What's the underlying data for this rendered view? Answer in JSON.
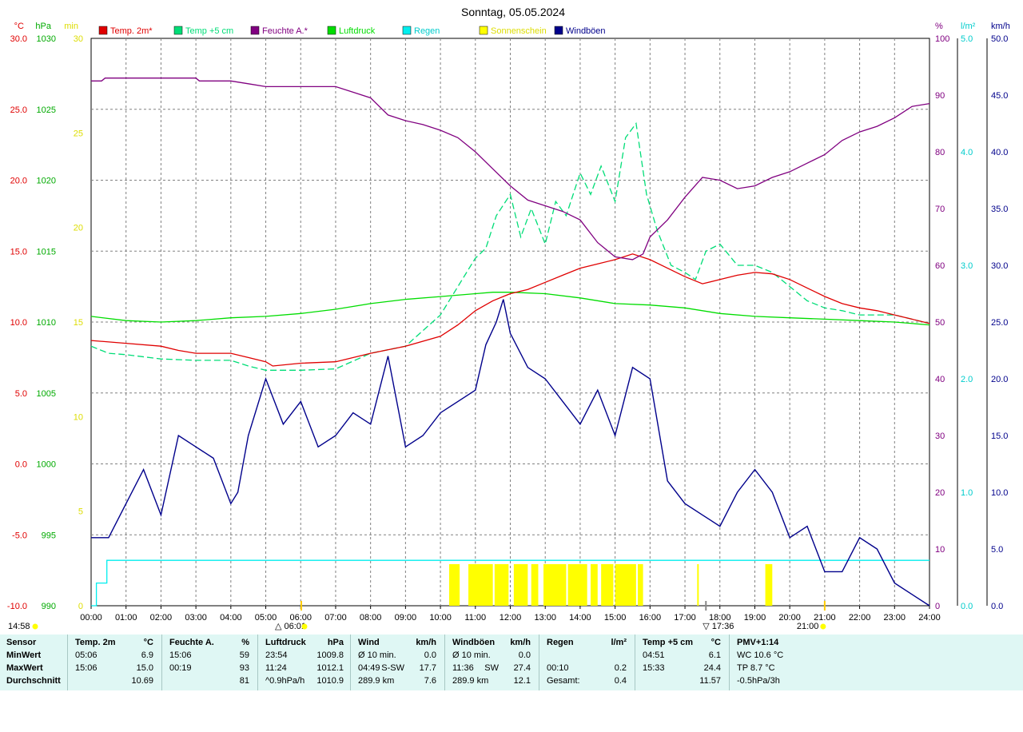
{
  "title": "Sonntag, 05.05.2024",
  "colors": {
    "temp": "#e00000",
    "temp5": "#00dd77",
    "humidity": "#800080",
    "pressure": "#00dd00",
    "rain": "#00eeee",
    "sun": "#ffff00",
    "gust": "#00008b",
    "grid": "#808080",
    "stats_bg": "#dff7f4"
  },
  "legend": [
    {
      "label": "Temp. 2m*",
      "color": "#e00000"
    },
    {
      "label": "Temp +5 cm",
      "color": "#00dd77"
    },
    {
      "label": "Feuchte A.*",
      "color": "#800080"
    },
    {
      "label": "Luftdruck",
      "color": "#00dd00"
    },
    {
      "label": "Regen",
      "color": "#00eeee"
    },
    {
      "label": "Sonnenschein",
      "color": "#ffff00"
    },
    {
      "label": "Windböen",
      "color": "#00008b"
    }
  ],
  "axes": {
    "left": [
      {
        "unit": "°C",
        "color": "#e00000",
        "ticks": [
          "30.0",
          "25.0",
          "20.0",
          "15.0",
          "10.0",
          "5.0",
          "0.0",
          "-5.0",
          "-10.0"
        ]
      },
      {
        "unit": "hPa",
        "color": "#00aa00",
        "ticks": [
          "1030",
          "1025",
          "1020",
          "1015",
          "1010",
          "1005",
          "1000",
          "995",
          "990"
        ]
      },
      {
        "unit": "min",
        "color": "#dddd00",
        "ticks": [
          "30",
          "25",
          "20",
          "15",
          "10",
          "5",
          "0"
        ]
      }
    ],
    "right": [
      {
        "unit": "%",
        "color": "#800080",
        "ticks": [
          "100",
          "90",
          "80",
          "70",
          "60",
          "50",
          "40",
          "30",
          "20",
          "10",
          "0"
        ]
      },
      {
        "unit": "l/m²",
        "color": "#00cccc",
        "ticks": [
          "5.0",
          "4.0",
          "3.0",
          "2.0",
          "1.0",
          "0.0"
        ]
      },
      {
        "unit": "km/h",
        "color": "#00008b",
        "ticks": [
          "50.0",
          "45.0",
          "40.0",
          "35.0",
          "30.0",
          "25.0",
          "20.0",
          "15.0",
          "10.0",
          "5.0",
          "0.0"
        ]
      }
    ],
    "x_ticks": [
      "00:00",
      "01:00",
      "02:00",
      "03:00",
      "04:00",
      "05:00",
      "06:00",
      "07:00",
      "08:00",
      "09:00",
      "10:00",
      "11:00",
      "12:00",
      "13:00",
      "14:00",
      "15:00",
      "16:00",
      "17:00",
      "18:00",
      "19:00",
      "20:00",
      "21:00",
      "22:00",
      "23:00",
      "24:00"
    ]
  },
  "markers": {
    "left_time": "14:58",
    "sunrise": "06:01",
    "sunset": "17:36",
    "moon": "21:00"
  },
  "chart_data": {
    "type": "line",
    "title": "Sonntag, 05.05.2024",
    "x_unit": "hour",
    "xlim": [
      0,
      24
    ],
    "grid": true,
    "legend_position": "top",
    "series": [
      {
        "name": "Temp. 2m*",
        "axis": "°C",
        "ylim": [
          -10,
          30
        ],
        "x": [
          0,
          1,
          2,
          2.5,
          3,
          4,
          4.5,
          5,
          5.2,
          6,
          7,
          8,
          9,
          10,
          10.5,
          11,
          11.5,
          11.8,
          12,
          12.5,
          13,
          13.5,
          14,
          14.5,
          15,
          15.5,
          16,
          16.5,
          17,
          17.5,
          18,
          18.5,
          19,
          19.5,
          20,
          20.5,
          21,
          21.5,
          22,
          22.5,
          23,
          23.5,
          24
        ],
        "y": [
          8.7,
          8.5,
          8.3,
          8.0,
          7.8,
          7.8,
          7.5,
          7.2,
          6.9,
          7.1,
          7.2,
          7.8,
          8.3,
          9.0,
          9.8,
          10.8,
          11.5,
          11.8,
          12.0,
          12.3,
          12.8,
          13.3,
          13.8,
          14.1,
          14.4,
          14.8,
          14.4,
          13.8,
          13.2,
          12.7,
          13.0,
          13.3,
          13.5,
          13.4,
          13.0,
          12.4,
          11.8,
          11.3,
          11.0,
          10.8,
          10.5,
          10.2,
          9.9
        ]
      },
      {
        "name": "Temp +5 cm",
        "axis": "°C",
        "ylim": [
          -10,
          30
        ],
        "x": [
          0,
          0.5,
          1,
          2,
          3,
          4,
          4.5,
          5,
          5.5,
          6,
          7,
          8,
          9,
          10,
          10.5,
          11,
          11.3,
          11.6,
          12,
          12.3,
          12.6,
          13,
          13.3,
          13.6,
          14,
          14.3,
          14.6,
          15,
          15.3,
          15.6,
          15.9,
          16.2,
          16.6,
          17,
          17.3,
          17.6,
          18,
          18.5,
          19,
          19.5,
          20,
          20.5,
          21,
          21.5,
          22,
          23,
          23.5,
          24
        ],
        "y": [
          8.3,
          7.8,
          7.7,
          7.4,
          7.3,
          7.3,
          6.9,
          6.6,
          6.6,
          6.6,
          6.7,
          7.8,
          8.3,
          10.5,
          12.5,
          14.5,
          15.2,
          17.5,
          19.0,
          16.0,
          18.0,
          15.5,
          18.5,
          17.5,
          20.5,
          19.0,
          21.0,
          18.5,
          23.0,
          24.0,
          19.0,
          16.5,
          14.0,
          13.5,
          13.0,
          15.0,
          15.5,
          14.0,
          14.0,
          13.5,
          12.5,
          11.5,
          11.0,
          10.8,
          10.5,
          10.5,
          10.2,
          9.9
        ]
      },
      {
        "name": "Feuchte A.*",
        "axis": "%",
        "ylim": [
          0,
          100
        ],
        "x": [
          0,
          0.3,
          0.4,
          1,
          2,
          3,
          3.1,
          4,
          4.5,
          5,
          5.5,
          6,
          7,
          7.5,
          8,
          8.5,
          9,
          9.5,
          10,
          10.5,
          11,
          11.5,
          12,
          12.5,
          13,
          13.5,
          14,
          14.5,
          15,
          15.5,
          15.8,
          16,
          16.5,
          17,
          17.5,
          18,
          18.5,
          19,
          19.5,
          20,
          20.5,
          21,
          21.5,
          22,
          22.5,
          23,
          23.5,
          24
        ],
        "y": [
          92.5,
          92.5,
          93,
          93,
          93,
          93,
          92.5,
          92.5,
          92.0,
          91.5,
          91.5,
          91.5,
          91.5,
          90.5,
          89.5,
          86.5,
          85.5,
          84.8,
          83.8,
          82.5,
          80,
          77,
          74,
          71.5,
          70.5,
          69.5,
          68,
          64,
          61.5,
          61.0,
          62,
          65,
          68,
          72,
          75.5,
          75,
          73.5,
          74,
          75.5,
          76.5,
          78,
          79.5,
          82,
          83.5,
          84.5,
          86,
          88,
          88.5
        ]
      },
      {
        "name": "Luftdruck",
        "axis": "hPa",
        "ylim": [
          990,
          1030
        ],
        "x": [
          0,
          1,
          2,
          3,
          4,
          5,
          6,
          7,
          8,
          9,
          10,
          11,
          11.5,
          12,
          13,
          14,
          15,
          16,
          17,
          18,
          19,
          20,
          21,
          22,
          23,
          24
        ],
        "y": [
          1010.4,
          1010.1,
          1010.0,
          1010.1,
          1010.3,
          1010.4,
          1010.6,
          1010.9,
          1011.3,
          1011.6,
          1011.8,
          1012.0,
          1012.1,
          1012.1,
          1012.0,
          1011.7,
          1011.3,
          1011.2,
          1011.0,
          1010.6,
          1010.4,
          1010.3,
          1010.2,
          1010.1,
          1010.0,
          1009.8
        ]
      },
      {
        "name": "Regen",
        "axis": "l/m²",
        "ylim": [
          0,
          5
        ],
        "x": [
          0,
          0.15,
          0.15,
          0.45,
          0.45,
          24
        ],
        "y": [
          0,
          0,
          0.2,
          0.2,
          0.4,
          0.4
        ]
      },
      {
        "name": "Windböen",
        "axis": "km/h",
        "ylim": [
          0,
          50
        ],
        "x": [
          0,
          0.5,
          1,
          1.5,
          2,
          2.5,
          3,
          3.5,
          4,
          4.2,
          4.5,
          5,
          5.5,
          6,
          6.5,
          7,
          7.5,
          8,
          8.5,
          9,
          9.5,
          10,
          10.5,
          11,
          11.3,
          11.6,
          11.8,
          12,
          12.5,
          13,
          13.5,
          14,
          14.5,
          15,
          15.5,
          16,
          16.5,
          17,
          17.5,
          18,
          18.5,
          19,
          19.5,
          20,
          20.5,
          21,
          21.5,
          22,
          22.5,
          23,
          23.5,
          24
        ],
        "y": [
          6,
          6,
          9,
          12,
          8,
          15,
          14,
          13,
          9,
          10,
          15,
          20,
          16,
          18,
          14,
          15,
          17,
          16,
          22,
          14,
          15,
          17,
          18,
          19,
          23,
          25,
          27,
          24,
          21,
          20,
          18,
          16,
          19,
          15,
          21,
          20,
          11,
          9,
          8,
          7,
          10,
          12,
          10,
          6,
          7,
          3,
          3,
          6,
          5,
          2,
          1,
          0
        ]
      }
    ],
    "sunshine_minutes": {
      "axis": "min",
      "ylim": [
        0,
        30
      ],
      "intervals": [
        [
          10.25,
          10.55
        ],
        [
          10.8,
          11.5
        ],
        [
          11.55,
          11.95
        ],
        [
          12.1,
          12.5
        ],
        [
          12.6,
          12.8
        ],
        [
          12.95,
          13.6
        ],
        [
          13.65,
          14.2
        ],
        [
          14.3,
          14.5
        ],
        [
          14.6,
          14.95
        ],
        [
          15.0,
          15.6
        ],
        [
          15.65,
          15.8
        ],
        [
          17.35,
          17.38
        ],
        [
          19.3,
          19.5
        ]
      ],
      "value": 1
    }
  },
  "stats": {
    "row_labels": [
      "Sensor",
      "MinWert",
      "MaxWert",
      "Durchschnitt"
    ],
    "columns": [
      {
        "title": "Temp. 2m",
        "unit": "°C",
        "rows": [
          [
            "05:06",
            "6.9"
          ],
          [
            "15:06",
            "15.0"
          ],
          [
            "",
            "10.69"
          ]
        ]
      },
      {
        "title": "Feuchte A.",
        "unit": "%",
        "rows": [
          [
            "15:06",
            "59"
          ],
          [
            "00:19",
            "93"
          ],
          [
            "",
            "81"
          ]
        ]
      },
      {
        "title": "Luftdruck",
        "unit": "hPa",
        "rows": [
          [
            "23:54",
            "1009.8"
          ],
          [
            "11:24",
            "1012.1"
          ],
          [
            "^0.9hPa/h",
            "1010.9"
          ]
        ]
      },
      {
        "title": "Wind",
        "unit": "km/h",
        "rows": [
          [
            "Ø 10 min.",
            "",
            "0.0"
          ],
          [
            "04:49",
            "S-SW",
            "17.7"
          ],
          [
            "289.9 km",
            "",
            "7.6"
          ]
        ]
      },
      {
        "title": "Windböen",
        "unit": "km/h",
        "rows": [
          [
            "Ø 10 min.",
            "",
            "0.0"
          ],
          [
            "11:36",
            "SW",
            "27.4"
          ],
          [
            "289.9 km",
            "",
            "12.1"
          ]
        ]
      },
      {
        "title": "Regen",
        "unit": "l/m²",
        "rows": [
          [
            "",
            ""
          ],
          [
            "00:10",
            "0.2"
          ],
          [
            "Gesamt:",
            "0.4"
          ]
        ]
      },
      {
        "title": "Temp +5 cm",
        "unit": "°C",
        "rows": [
          [
            "04:51",
            "6.1"
          ],
          [
            "15:33",
            "24.4"
          ],
          [
            "",
            "11.57"
          ]
        ]
      },
      {
        "title": "PMV+1:14",
        "unit": "",
        "rows": [
          [
            "WC 10.6 °C"
          ],
          [
            "TP 8.7 °C"
          ],
          [
            "-0.5hPa/3h"
          ]
        ]
      }
    ]
  }
}
